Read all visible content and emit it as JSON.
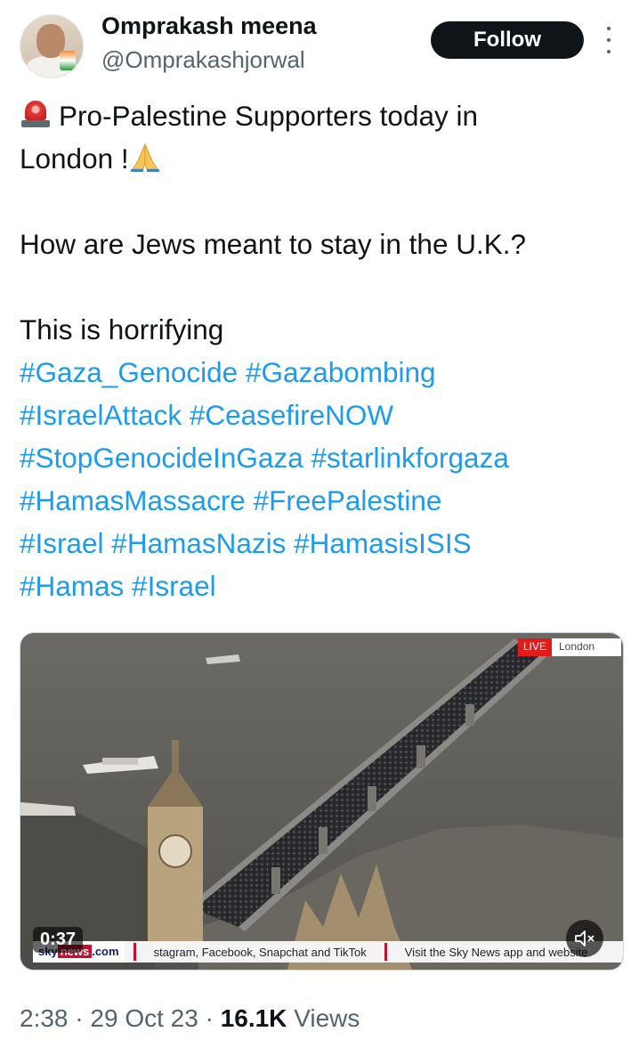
{
  "author": {
    "name": "Omprakash meena",
    "handle": "@Omprakashjorwal"
  },
  "actions": {
    "follow_label": "Follow"
  },
  "tweet": {
    "line1": "Pro-Palestine Supporters today in",
    "line2": "London !",
    "line3": "How are Jews meant to stay in the U.K.?",
    "line4": "This is horrifying",
    "hashtag_lines": [
      "#Gaza_Genocide #Gazabombing",
      "#IsraelAttack #CeasefireNOW",
      "#StopGenocideInGaza #starlinkforgaza",
      "#HamasMassacre #FreePalestine",
      "#Israel #HamasNazis #HamasisISIS",
      "#Hamas #Israel"
    ]
  },
  "video": {
    "duration": "0:37",
    "live_label": "LIVE",
    "live_location": "London",
    "ticker_logo_sky": "sky",
    "ticker_logo_news": "news",
    "ticker_logo_domain": ".com",
    "ticker_segment_1": "stagram, Facebook, Snapchat and TikTok",
    "ticker_segment_2": "Visit the Sky News app and website"
  },
  "meta": {
    "time": "2:38",
    "dot1": "·",
    "date": "29 Oct 23",
    "dot2": "·",
    "views_count": "16.1K",
    "views_label": "Views"
  },
  "colors": {
    "link": "#1d9bf0",
    "secondary_text": "#536471",
    "primary_text": "#0f1419",
    "follow_bg": "#0f1419"
  },
  "icons": [
    "siren-emoji-icon",
    "folded-hands-emoji-icon",
    "more-icon",
    "mute-icon"
  ]
}
